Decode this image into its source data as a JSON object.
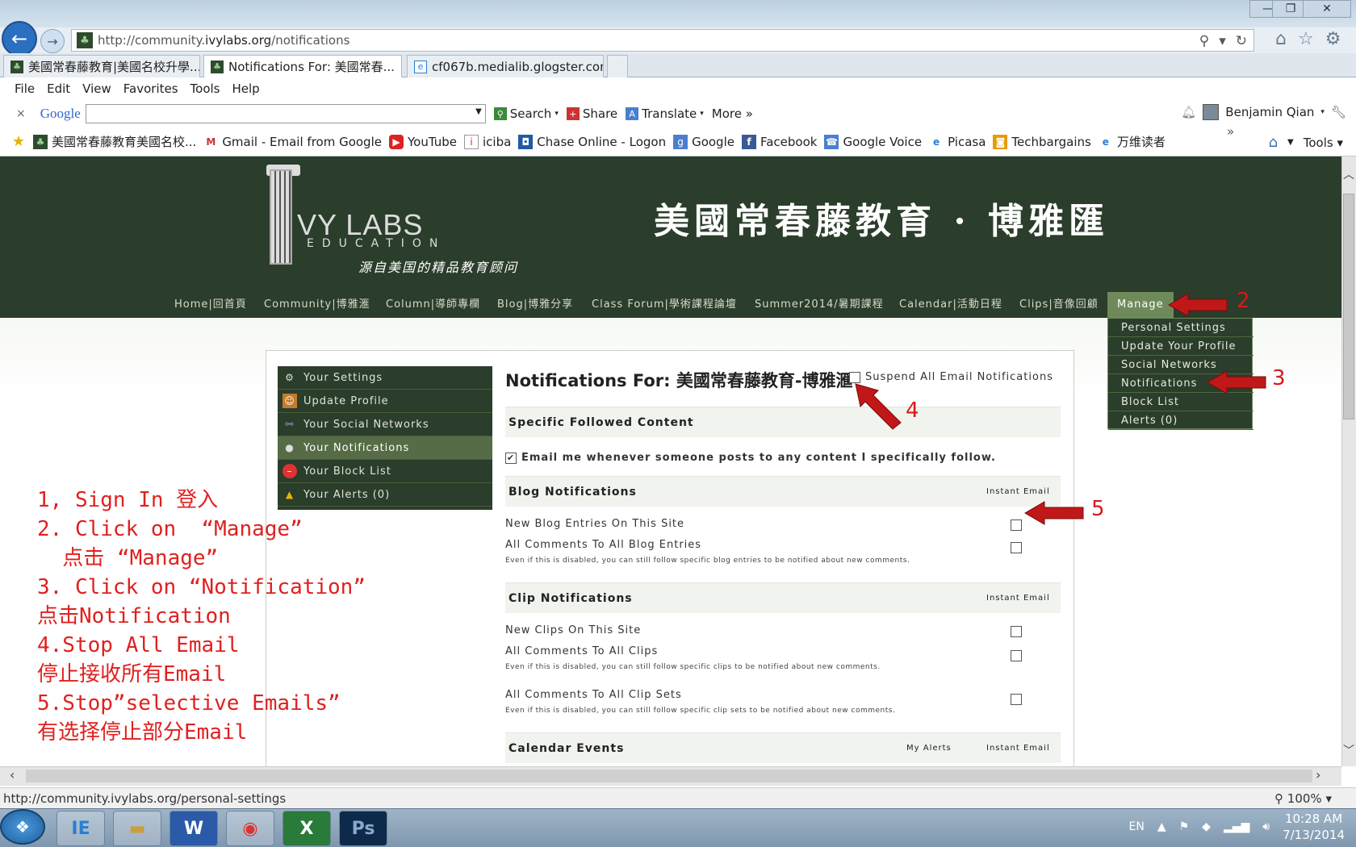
{
  "browser": {
    "url_prefix": "http://community.",
    "url_domain": "ivylabs.org",
    "url_path": "/notifications",
    "window_controls": {
      "minimize": "—",
      "restore": "❐",
      "close": "✕"
    },
    "tabs": [
      {
        "label": "美國常春藤教育|美國名校升學..."
      },
      {
        "label": "Notifications For: 美國常春...",
        "active": true
      },
      {
        "label": "cf067b.medialib.glogster.com"
      }
    ],
    "menu": [
      "File",
      "Edit",
      "View",
      "Favorites",
      "Tools",
      "Help"
    ],
    "google_toolbar": {
      "close": "×",
      "logo": "Google",
      "search": "Search",
      "share": "Share",
      "translate": "Translate",
      "more": "More »",
      "user": "Benjamin Qian"
    },
    "favorites": [
      {
        "label": "美國常春藤教育美國名校...",
        "icon": "ivy-icon"
      },
      {
        "label": "Gmail - Email from Google",
        "icon": "gmail-icon"
      },
      {
        "label": "YouTube",
        "icon": "youtube-icon"
      },
      {
        "label": "iciba",
        "icon": "iciba-icon"
      },
      {
        "label": "Chase Online - Logon",
        "icon": "chase-icon"
      },
      {
        "label": "Google",
        "icon": "google-icon"
      },
      {
        "label": "Facebook",
        "icon": "facebook-icon"
      },
      {
        "label": "Google Voice",
        "icon": "voice-icon"
      },
      {
        "label": "Picasa",
        "icon": "picasa-icon"
      },
      {
        "label": "Techbargains",
        "icon": "techbargains-icon"
      },
      {
        "label": "万维读者",
        "icon": "ie-page-icon"
      }
    ],
    "favorites_more": "»",
    "tools_label": "Tools",
    "status_url": "http://community.ivylabs.org/personal-settings",
    "zoom": "100%"
  },
  "site": {
    "logo_text": "VY LABS",
    "logo_sub": "EDUCATION",
    "tagline": "源自美国的精品教育顾问",
    "title": "美國常春藤教育 · 博雅匯",
    "nav": [
      "Home|回首頁",
      "Community|博雅滙",
      "Column|導師專欄",
      "Blog|博雅分享",
      "Class Forum|學術課程論壇",
      "Summer2014/暑期課程",
      "Calendar|活動日程",
      "Clips|音像回顧",
      "Manage"
    ],
    "manage_menu": [
      "Personal Settings",
      "Update Your Profile",
      "Social Networks",
      "Notifications",
      "Block List",
      "Alerts (0)"
    ]
  },
  "sidebar": [
    {
      "label": "Your Settings",
      "icon": "gear-icon"
    },
    {
      "label": "Update Profile",
      "icon": "profile-icon"
    },
    {
      "label": "Your Social Networks",
      "icon": "network-icon"
    },
    {
      "label": "Your Notifications",
      "icon": "notification-icon",
      "active": true
    },
    {
      "label": "Your Block List",
      "icon": "block-icon"
    },
    {
      "label": "Your Alerts (0)",
      "icon": "alert-icon"
    }
  ],
  "notifications": {
    "title": "Notifications For: 美國常春藤教育-博雅滙",
    "suspend_label": "Suspend All Email Notifications",
    "suspend_checked": false,
    "followed_header": "Specific Followed Content",
    "followed_label": "Email me whenever someone posts to any content I specifically follow.",
    "followed_checked": true,
    "blog_header": "Blog Notifications",
    "instant_email": "Instant Email",
    "my_alerts": "My Alerts",
    "blog_rows": [
      "New Blog Entries On This Site",
      "All Comments To All Blog Entries"
    ],
    "blog_hint": "Even if this is disabled, you can still follow specific blog entries to be notified about new comments.",
    "clip_header": "Clip Notifications",
    "clip_rows": [
      "New Clips On This Site",
      "All Comments To All Clips",
      "All Comments To All Clip Sets"
    ],
    "clip_hint": "Even if this is disabled, you can still follow specific clips to be notified about new comments.",
    "clipset_hint": "Even if this is disabled, you can still follow specific clip sets to be notified about new comments.",
    "calendar_header": "Calendar Events"
  },
  "annotations": {
    "numbers": [
      "2",
      "3",
      "4",
      "5"
    ],
    "instructions": "1, Sign In 登入\n2. Click on  “Manage”\n  点击 “Manage”\n3. Click on “Notification”\n点击Notification\n4.Stop All Email\n停止接收所有Email\n5.Stop”selective Emails”\n有选择停止部分Email",
    "color": "#d81818"
  },
  "taskbar": {
    "apps": [
      "IE",
      "Explorer",
      "W",
      "Chrome",
      "X",
      "Ps"
    ],
    "lang": "EN",
    "time": "10:28 AM",
    "date": "7/13/2014"
  }
}
